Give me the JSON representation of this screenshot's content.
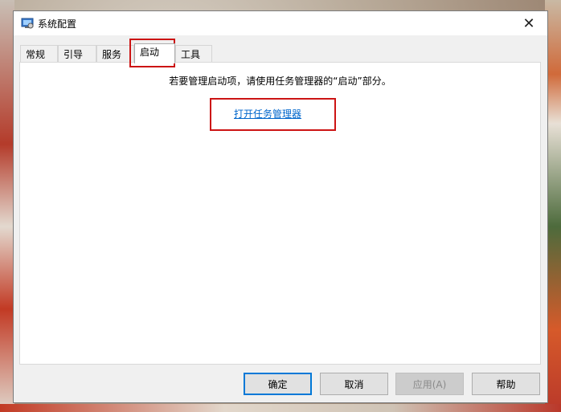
{
  "window": {
    "title": "系统配置",
    "close_glyph": "✕"
  },
  "tabs": [
    {
      "label": "常规"
    },
    {
      "label": "引导"
    },
    {
      "label": "服务"
    },
    {
      "label": "启动",
      "active": true
    },
    {
      "label": "工具"
    }
  ],
  "startup": {
    "info_text": "若要管理启动项，请使用任务管理器的“启动”部分。",
    "link_text": "打开任务管理器"
  },
  "buttons": {
    "ok": "确定",
    "cancel": "取消",
    "apply": "应用(A)",
    "help": "帮助"
  },
  "colors": {
    "highlight": "#cc1414",
    "link": "#0066cc",
    "primary_border": "#0078d7"
  },
  "icons": {
    "app": "system-config-icon",
    "close": "close-icon"
  }
}
